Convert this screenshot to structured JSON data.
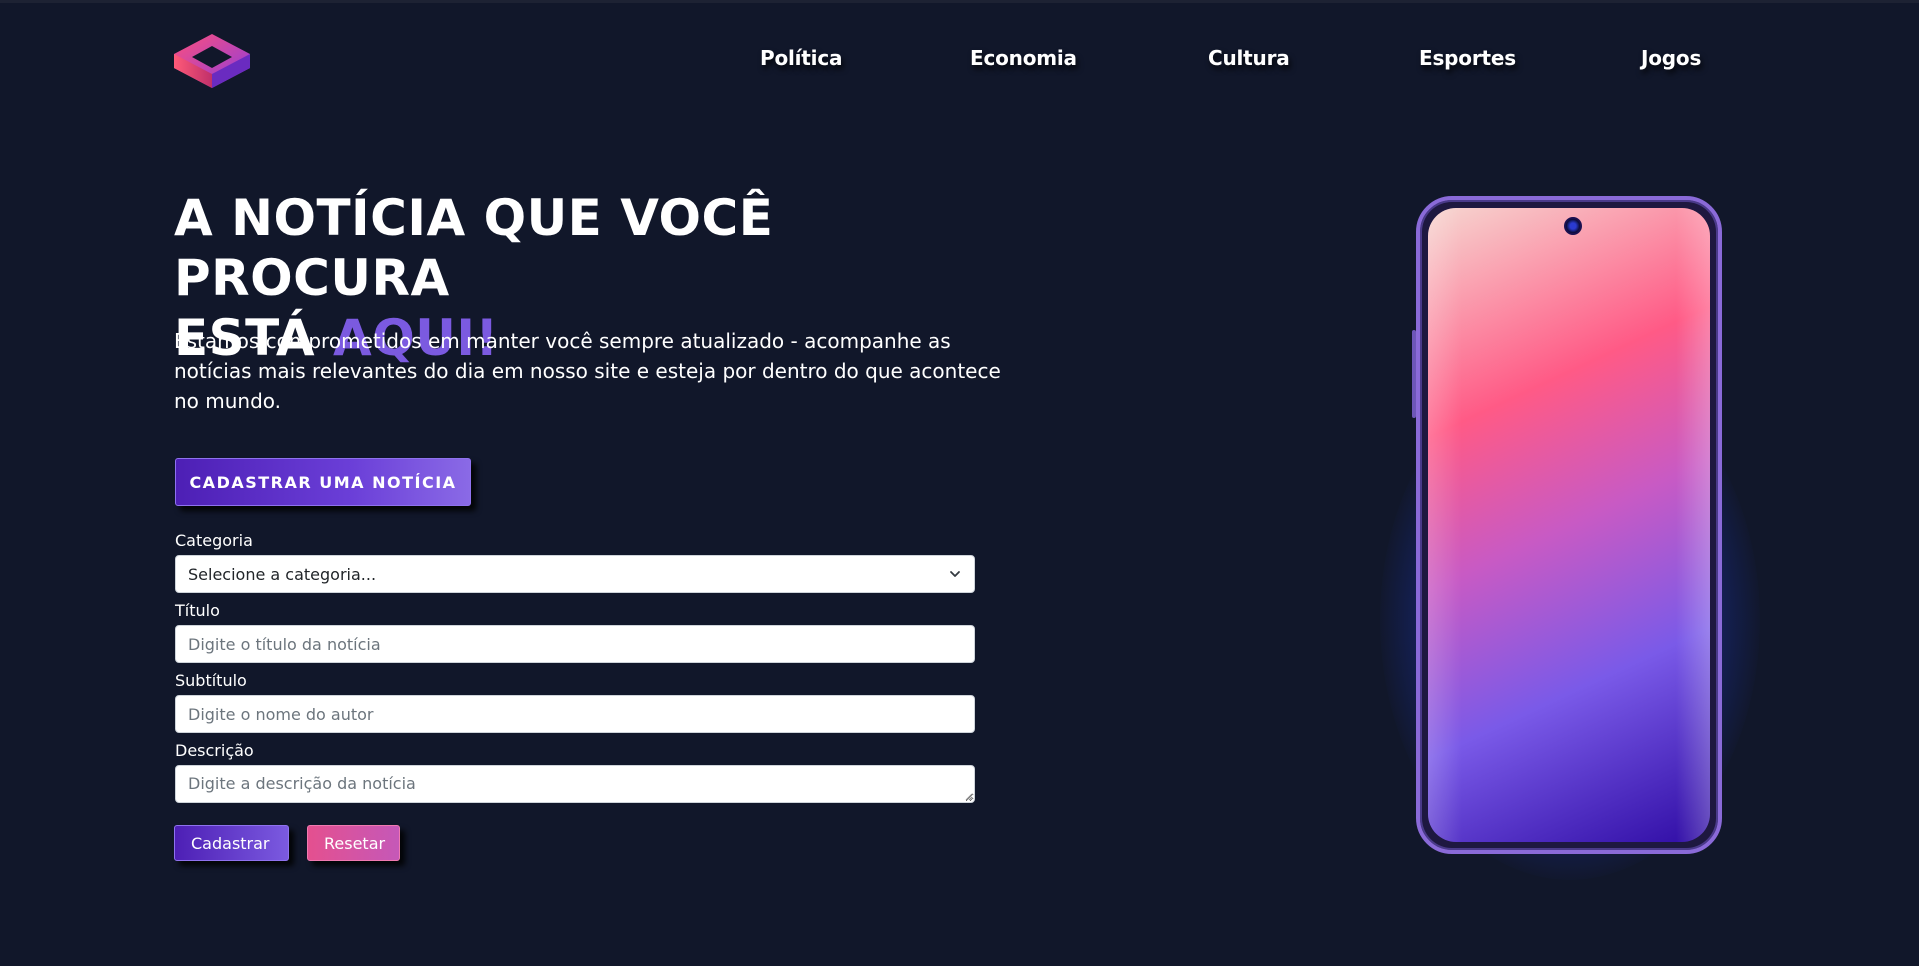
{
  "nav": {
    "items": [
      {
        "label": "Política"
      },
      {
        "label": "Economia"
      },
      {
        "label": "Cultura"
      },
      {
        "label": "Esportes"
      },
      {
        "label": "Jogos"
      }
    ]
  },
  "hero": {
    "title_line1": "A NOTÍCIA QUE VOCÊ PROCURA",
    "title_line2_prefix": "ESTÁ",
    "title_line2_accent": "AQUI!",
    "description": "Estamos comprometidos em manter você sempre atualizado - acompanhe as notícias mais relevantes do dia em nosso site e esteja por dentro do que acontece no mundo.",
    "cta_label": "CADASTRAR UMA NOTÍCIA"
  },
  "form": {
    "category": {
      "label": "Categoria",
      "selected": "Selecione a categoria..."
    },
    "title": {
      "label": "Título",
      "placeholder": "Digite o título da notícia"
    },
    "subtitle": {
      "label": "Subtítulo",
      "placeholder": "Digite o nome do autor"
    },
    "description": {
      "label": "Descrição",
      "placeholder": "Digite a descrição da notícia"
    },
    "submit_label": "Cadastrar",
    "reset_label": "Resetar"
  },
  "colors": {
    "background": "#11172a",
    "accent": "#7b5ae0",
    "button_primary": "#4d1fb5",
    "button_reset": "#e4508f"
  },
  "icons": {
    "logo": "cube-logo-icon",
    "select_arrow": "chevron-down-icon"
  }
}
